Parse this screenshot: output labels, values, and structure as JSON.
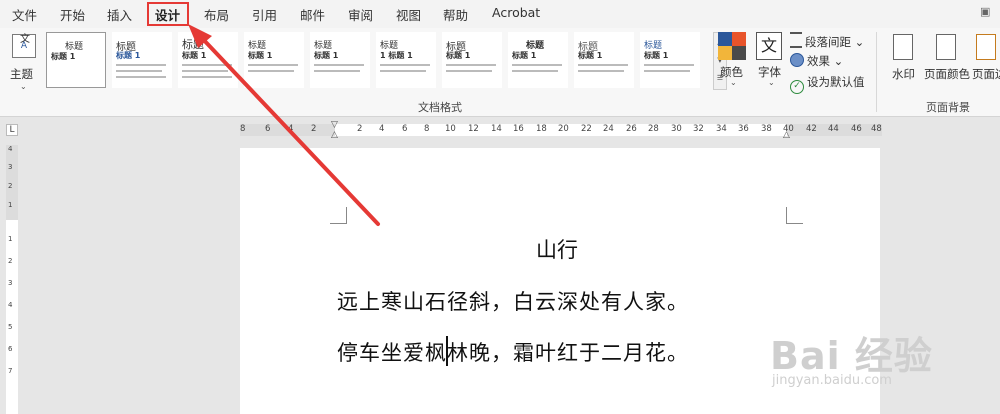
{
  "menu": {
    "tabs": [
      "文件",
      "开始",
      "插入",
      "设计",
      "布局",
      "引用",
      "邮件",
      "审阅",
      "视图",
      "帮助",
      "Acrobat"
    ],
    "active_tab": "设计"
  },
  "ribbon": {
    "theme": {
      "label": "主题",
      "icon": "theme-icon"
    },
    "document_format": {
      "group_label": "文档格式",
      "style_cards": [
        {
          "title": "标题",
          "heading": "标题 1"
        },
        {
          "title": "标题",
          "heading": "标题 1"
        },
        {
          "title": "标题",
          "heading": "标题 1"
        },
        {
          "title": "标题",
          "heading": "标题 1"
        },
        {
          "title": "标题",
          "heading": "标题 1"
        },
        {
          "title": "标题",
          "heading": "1 标题 1"
        },
        {
          "title": "标题",
          "heading": "标题 1"
        },
        {
          "title": "标题",
          "heading": "标题 1"
        },
        {
          "title": "标题",
          "heading": "标题 1"
        },
        {
          "title": "标题",
          "heading": "标题 1"
        }
      ]
    },
    "colors": {
      "label": "颜色",
      "swatches": [
        "#2b579a",
        "#e8542b",
        "#f2b53a",
        "#4a4a4a"
      ]
    },
    "fonts": {
      "label": "字体",
      "glyph": "文"
    },
    "paragraph_spacing": "段落间距",
    "effects": "效果",
    "set_default": "设为默认值",
    "page_background": {
      "group_label": "页面背景",
      "watermark": "水印",
      "page_color": "页面颜色",
      "page_border": "页面边"
    }
  },
  "ruler": {
    "corner": "L",
    "horizontal_ticks": [
      "8",
      "6",
      "4",
      "2",
      "",
      "2",
      "4",
      "6",
      "8",
      "10",
      "12",
      "14",
      "16",
      "18",
      "20",
      "22",
      "24",
      "26",
      "28",
      "30",
      "32",
      "34",
      "36",
      "38",
      "40",
      "42",
      "44",
      "46",
      "48"
    ],
    "vertical_ticks": [
      "4",
      "3",
      "2",
      "1",
      "",
      "1",
      "2",
      "3",
      "4",
      "5",
      "6",
      "7"
    ]
  },
  "document": {
    "title": "山行",
    "lines": [
      "远上寒山石径斜，白云深处有人家。",
      "停车坐爱枫林晚，霜叶红于二月花。"
    ]
  },
  "watermark": {
    "logo_text": "Bai 经验",
    "url": "jingyan.baidu.com"
  },
  "colors": {
    "accent": "#2b579a",
    "annotation_red": "#e53935"
  }
}
